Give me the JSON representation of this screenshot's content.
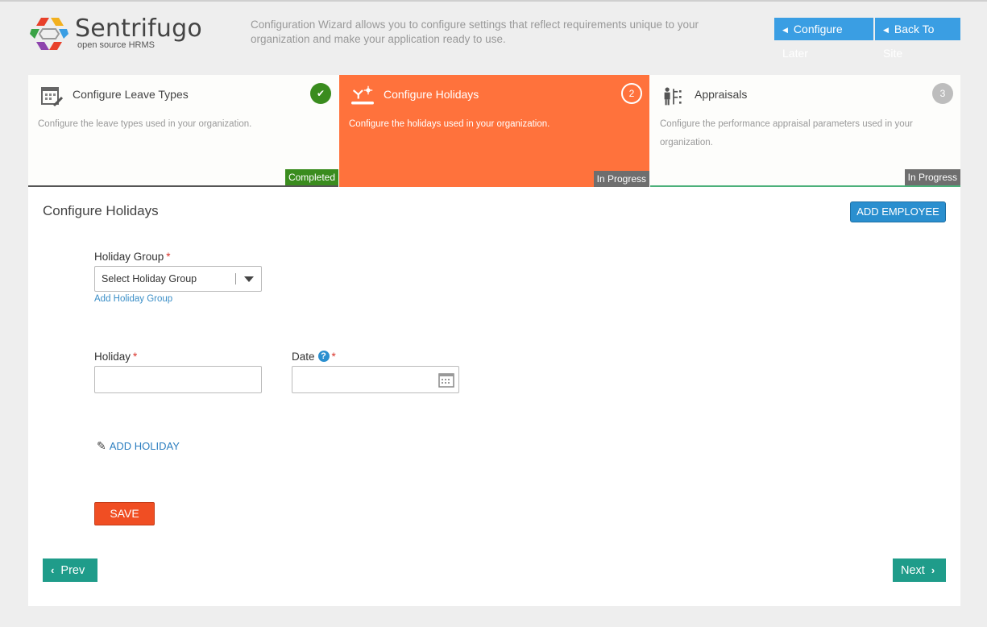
{
  "header": {
    "logo_title": "Sentrifugo",
    "logo_subtitle": "open source HRMS",
    "description": "Configuration Wizard allows you to configure settings that reflect requirements unique to your organization and make your application ready to use.",
    "configure_later_label": "Configure Later",
    "back_to_site_label": "Back To Site"
  },
  "steps": [
    {
      "title": "Configure Leave Types",
      "description": "Configure the leave types used in your organization.",
      "badge": "✔",
      "status": "Completed",
      "icon": "calendar-edit-icon"
    },
    {
      "title": "Configure Holidays",
      "description": "Configure the holidays used in your organization.",
      "badge": "2",
      "status": "In Progress",
      "icon": "holiday-icon"
    },
    {
      "title": "Appraisals",
      "description": "Configure the performance appraisal parameters used in your organization.",
      "badge": "3",
      "status": "In Progress",
      "icon": "appraisal-icon"
    }
  ],
  "form": {
    "page_title": "Configure Holidays",
    "add_employee_label": "ADD EMPLOYEE",
    "holiday_group_label": "Holiday Group",
    "holiday_group_selected": "Select Holiday Group",
    "add_holiday_group_link": "Add Holiday Group",
    "holiday_label": "Holiday",
    "holiday_value": "",
    "date_label": "Date",
    "date_value": "",
    "required_mark": "*",
    "help_mark": "?",
    "add_holiday_label": "ADD HOLIDAY",
    "save_label": "SAVE"
  },
  "nav": {
    "prev_label": "Prev",
    "next_label": "Next"
  },
  "colors": {
    "accent_blue": "#3a9ee3",
    "active_step": "#ff723c",
    "completed": "#3a8c1e",
    "save": "#f04e23",
    "nav": "#1f9c8a"
  }
}
